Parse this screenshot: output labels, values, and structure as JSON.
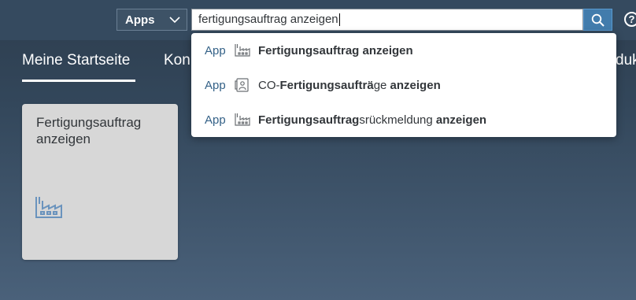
{
  "shell": {
    "scope_label": "Apps",
    "search_value": "fertigungsauftrag anzeigen",
    "help_label": "?"
  },
  "tabs": {
    "active": "Meine Startseite",
    "second_partial": "Kon",
    "right_partial": "duk"
  },
  "tile": {
    "title": "Fertigungsauftrag anzeigen",
    "icon": "factory-icon"
  },
  "suggestions": [
    {
      "type": "App",
      "icon": "factory-icon",
      "parts": [
        {
          "t": "Fertigungsauftrag anzeigen",
          "b": true
        }
      ]
    },
    {
      "type": "App",
      "icon": "co-order-icon",
      "parts": [
        {
          "t": "CO-",
          "b": false
        },
        {
          "t": "Fertigungsaufträ",
          "b": true
        },
        {
          "t": "ge ",
          "b": false
        },
        {
          "t": "anzeigen",
          "b": true
        }
      ]
    },
    {
      "type": "App",
      "icon": "factory-icon",
      "parts": [
        {
          "t": "Fertigungsauftrag",
          "b": true
        },
        {
          "t": "srückmeldung ",
          "b": false
        },
        {
          "t": "anzeigen",
          "b": true
        }
      ]
    }
  ],
  "colors": {
    "shellbar": "#354a5f",
    "accent": "#427cac",
    "tile_bg": "#d7d7d7",
    "app_label": "#346187"
  }
}
